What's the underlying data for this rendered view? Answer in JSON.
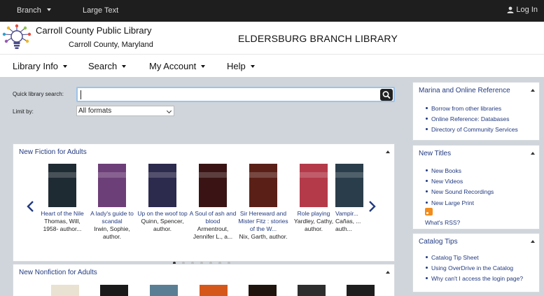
{
  "topbar": {
    "branch": "Branch",
    "large_text": "Large Text",
    "login": "Log In"
  },
  "header": {
    "library_name": "Carroll County Public Library",
    "county": "Carroll County, Maryland",
    "branch_title": "ELDERSBURG BRANCH LIBRARY"
  },
  "nav": [
    "Library Info",
    "Search",
    "My Account",
    "Help"
  ],
  "search": {
    "quick_label": "Quick library search:",
    "query": "",
    "limit_label": "Limit by:",
    "limit_selected": "All formats"
  },
  "new_fiction": {
    "title": "New Fiction for Adults",
    "books": [
      {
        "title": "Heart of the Nile",
        "author": "Thomas, Will, 1958- author...",
        "cover": "#1f2b33"
      },
      {
        "title": "A lady's guide to scandal",
        "author": "Irwin, Sophie, author.",
        "cover": "#6d3f78"
      },
      {
        "title": "Up on the woof top",
        "author": "Quinn, Spencer, author.",
        "cover": "#2c2a4d"
      },
      {
        "title": "A Soul of ash and blood",
        "author": "Armentrout, Jennifer L., a...",
        "cover": "#3a1414"
      },
      {
        "title": "Sir Hereward and Mister Fitz : stories of the W...",
        "author": "Nix, Garth, author.",
        "cover": "#5a2018"
      },
      {
        "title": "Role playing",
        "author": "Yardley, Cathy, author.",
        "cover": "#b43a4a"
      },
      {
        "title": "Vampir...",
        "author": "Cañas, ... auth...",
        "cover": "#2a3d4a"
      }
    ],
    "pages": 7,
    "active_page": 0
  },
  "new_nonfiction": {
    "title": "New Nonfiction for Adults",
    "covers": [
      "#e9e2d2",
      "#1a1a1a",
      "#5a7f95",
      "#d5581a",
      "#20140e",
      "#2e2e2e",
      "#1e1e1e"
    ]
  },
  "sidebar": [
    {
      "title": "Marina and Online Reference",
      "links": [
        "Borrow from other libraries",
        "Online Reference: Databases",
        "Directory of Community Services"
      ]
    },
    {
      "title": "New Titles",
      "links": [
        "New Books",
        "New Videos",
        "New Sound Recordings",
        "New Large Print"
      ],
      "rss_label": "What's RSS?"
    },
    {
      "title": "Catalog Tips",
      "links": [
        "Catalog Tip Sheet",
        "Using OverDrive in the Catalog",
        "Why can't I access the login page?"
      ]
    }
  ],
  "colors": {
    "link": "#233b80",
    "topbar": "#1e1e1e",
    "background": "#cfd5db"
  }
}
